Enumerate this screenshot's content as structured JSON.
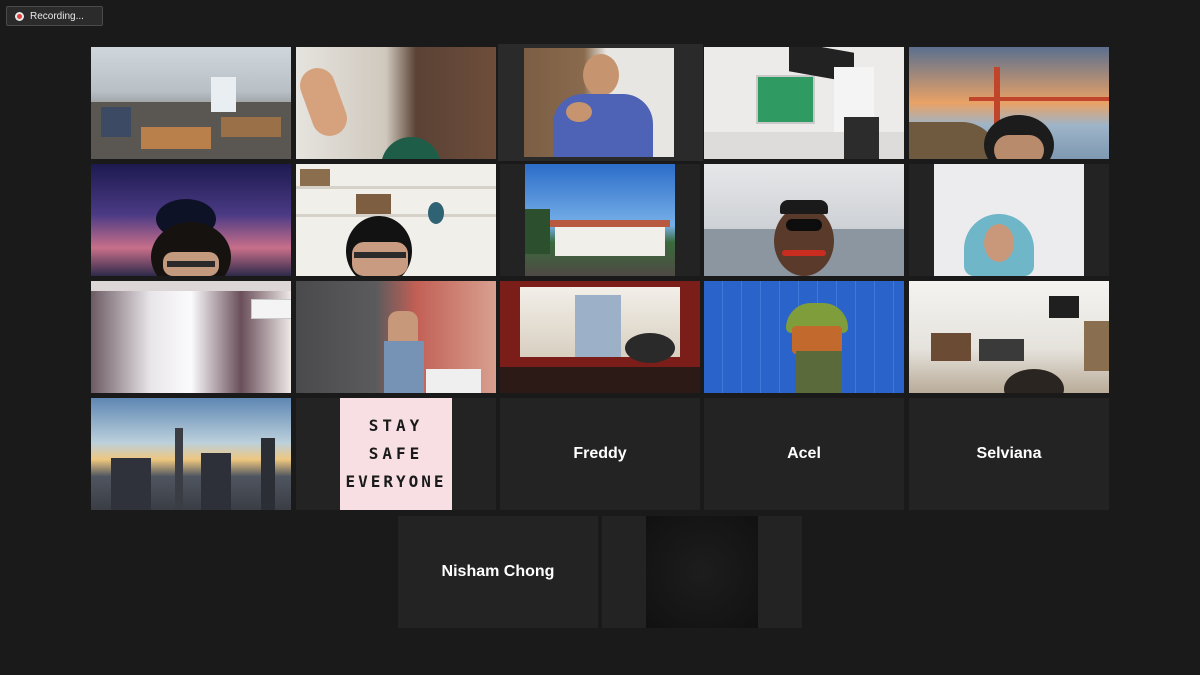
{
  "recording": {
    "label": "Recording...",
    "icon": "record-icon"
  },
  "participants_named": {
    "freddy": "Freddy",
    "acel": "Acel",
    "selviana": "Selviana",
    "nisham": "Nisham Chong"
  },
  "stay_safe": {
    "line1": "STAY",
    "line2": "SAFE",
    "line3": "EVERYONE"
  },
  "colors": {
    "background": "#1a1a1a",
    "tile": "#232323",
    "active_speaker_border": "#d9e36b",
    "recording_dot": "#e0423f"
  }
}
